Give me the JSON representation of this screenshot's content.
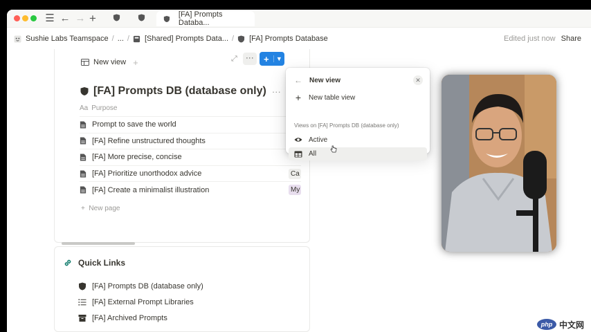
{
  "titlebar": {
    "active_tab": "[FA] Prompts Databa..."
  },
  "breadcrumb": {
    "items": [
      "Sushie Labs Teamspace",
      "...",
      "[Shared] Prompts Data...",
      "[FA] Prompts Database"
    ],
    "edited": "Edited just now",
    "share": "Share"
  },
  "database": {
    "view_label": "New view",
    "title": "[FA] Prompts DB (database only)",
    "title_more": "···",
    "column_header": "Purpose",
    "rows": [
      {
        "title": "Prompt to save the world",
        "tag": ""
      },
      {
        "title": "[FA] Refine unstructured thoughts",
        "tag": ""
      },
      {
        "title": "[FA] More precise, concise",
        "tag": ""
      },
      {
        "title": "[FA] Prioritize unorthodox advice",
        "tag": "Ca"
      },
      {
        "title": "[FA] Create a minimalist illustration",
        "tag": "My"
      }
    ],
    "new_page": "New page"
  },
  "quick_links": {
    "title": "Quick Links",
    "items": [
      {
        "label": "[FA] Prompts DB (database only)",
        "icon": "database-icon"
      },
      {
        "label": "[FA] External Prompt Libraries",
        "icon": "list-icon"
      },
      {
        "label": "[FA] Archived Prompts",
        "icon": "archive-icon"
      }
    ]
  },
  "popover": {
    "title": "New view",
    "new_table_view": "New table view",
    "section_label": "Views on [FA] Prompts DB (database only)",
    "views": [
      {
        "label": "Active",
        "icon": "eye-icon"
      },
      {
        "label": "All",
        "icon": "table-icon"
      }
    ]
  },
  "watermark": {
    "logo": "php",
    "text": "中文网"
  },
  "colors": {
    "accent": "#2383e2",
    "purple_tag": "#e8deee",
    "gray_tag": "#efefed"
  }
}
